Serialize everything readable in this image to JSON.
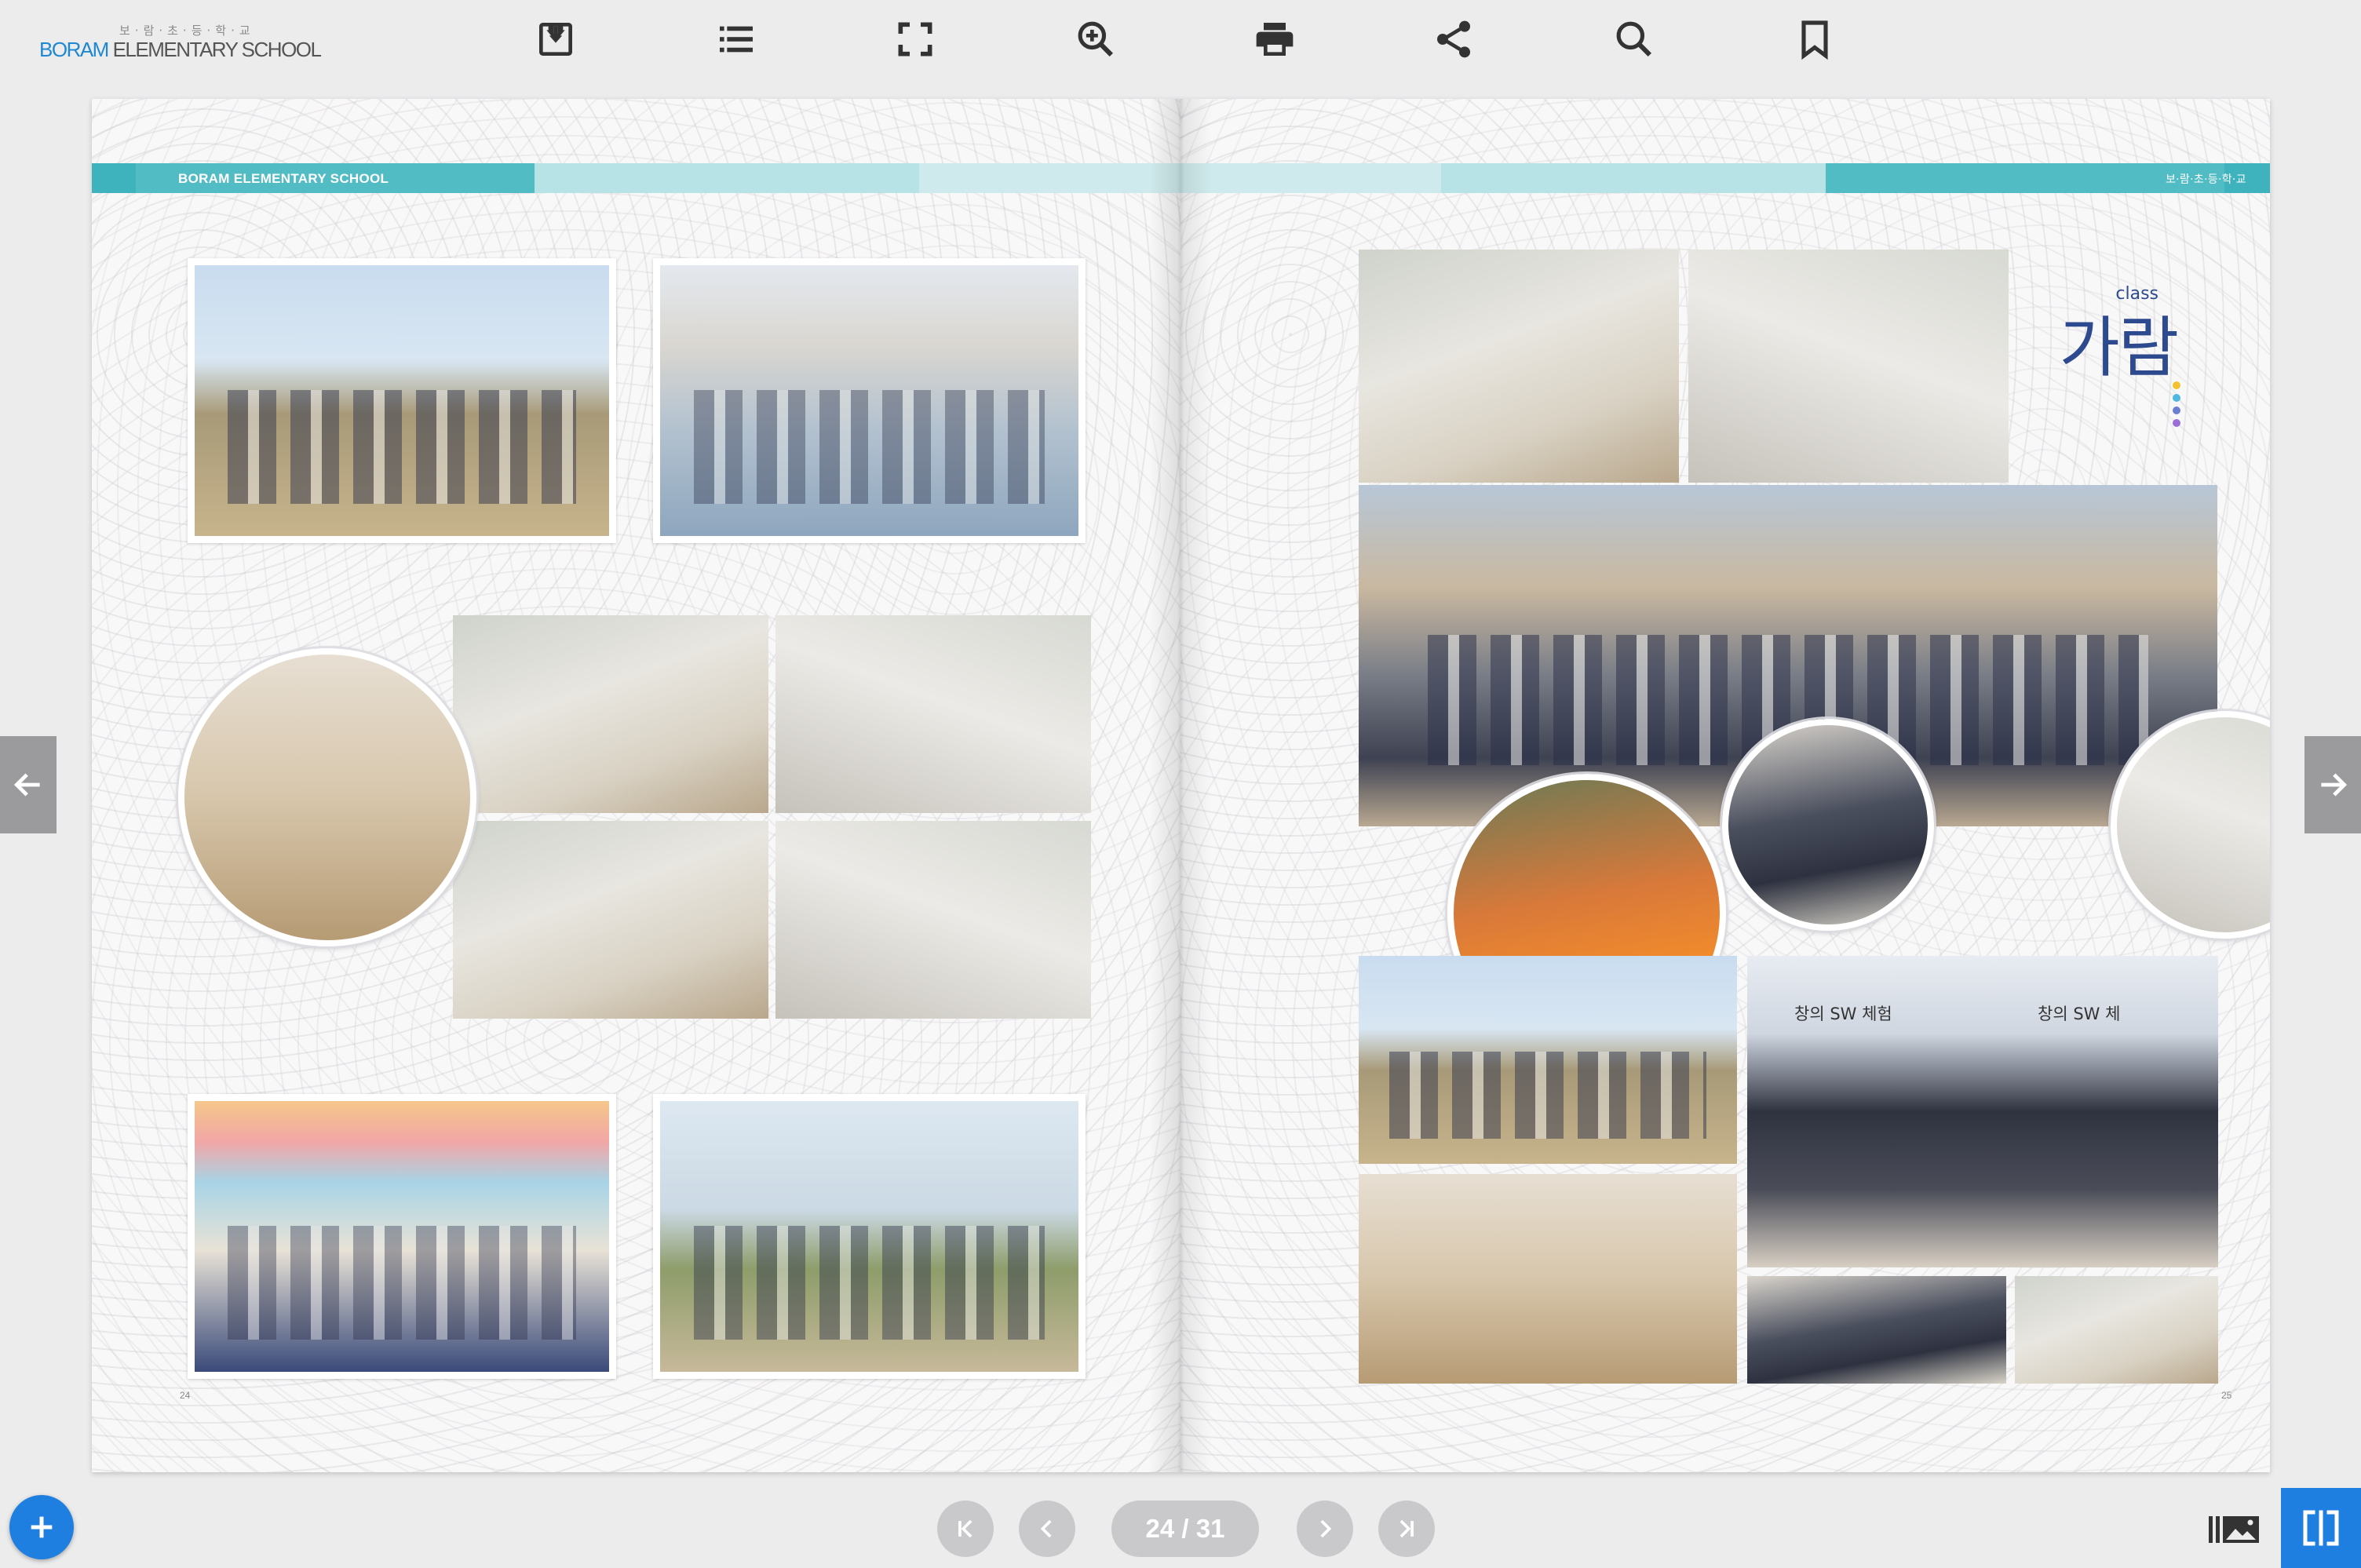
{
  "app": {
    "logo_korean": "보·람·초·등·학·교",
    "logo_en_highlight": "BORAM",
    "logo_en_rest": " ELEMENTARY SCHOOL"
  },
  "toolbar": {
    "icons": [
      "download-icon",
      "list-icon",
      "fullscreen-icon",
      "zoom-in-icon",
      "print-icon",
      "share-icon",
      "search-icon",
      "bookmark-icon"
    ]
  },
  "book": {
    "left_header": "BORAM ELEMENTARY SCHOOL",
    "right_header": "보·람·초·등·학·교",
    "left_page_number": "24",
    "right_page_number": "25",
    "class_label": "class",
    "class_name": "가람",
    "band_color": "#3fb3bd",
    "band_light": "#b7e2e6",
    "dot_colors": [
      "#f2c230",
      "#4fb8e0",
      "#6a7fd0",
      "#9a6ed8"
    ],
    "poster_text_1": "창의 SW 체험",
    "poster_text_2": "창의 SW 체"
  },
  "pager": {
    "current": "24 / 31"
  },
  "colors": {
    "accent": "#1e7fe0",
    "class_title": "#2d4a8e"
  }
}
